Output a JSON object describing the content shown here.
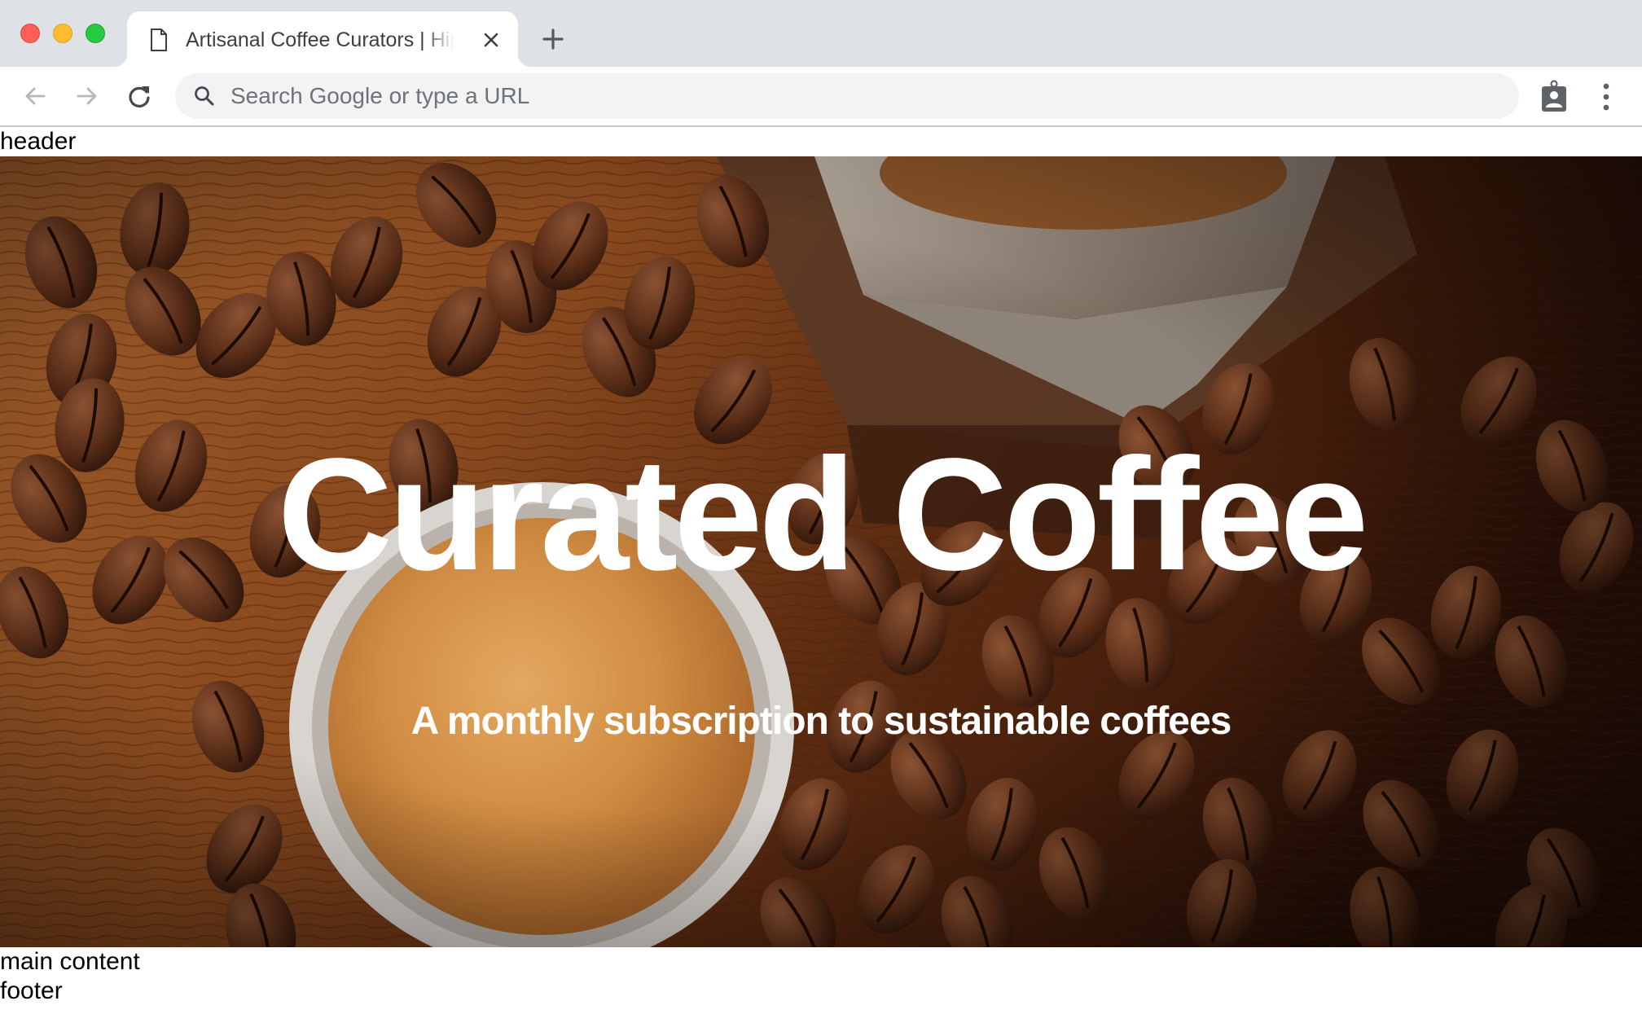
{
  "browser": {
    "window_controls": [
      "close",
      "minimize",
      "maximize"
    ],
    "tab": {
      "title": "Artisanal Coffee Curators | Hipster Coffee",
      "icon": "document-icon",
      "close_icon": "close-icon"
    },
    "new_tab_icon": "plus-icon",
    "nav": {
      "back_icon": "arrow-left-icon",
      "forward_icon": "arrow-right-icon",
      "reload_icon": "reload-icon"
    },
    "omnibox": {
      "value": "",
      "placeholder": "Search Google or type a URL",
      "icon": "search-icon"
    },
    "toolbar_icons": [
      "badge-icon",
      "more-vertical-icon"
    ]
  },
  "page": {
    "header_label": "header",
    "hero": {
      "title": "Curated Coffee",
      "subtitle": "A monthly subscription to sustainable coffees",
      "image_description": "coffee beans on wooden table with espresso cup and grinder"
    },
    "main_label": "main content",
    "footer_label": "footer"
  },
  "colors": {
    "tabstrip": "#dee1e6",
    "omnibox": "#f1f3f4",
    "traffic_red": "#fe5f57",
    "traffic_yellow": "#febc2e",
    "traffic_green": "#28c840",
    "hero_text": "#ffffff"
  }
}
